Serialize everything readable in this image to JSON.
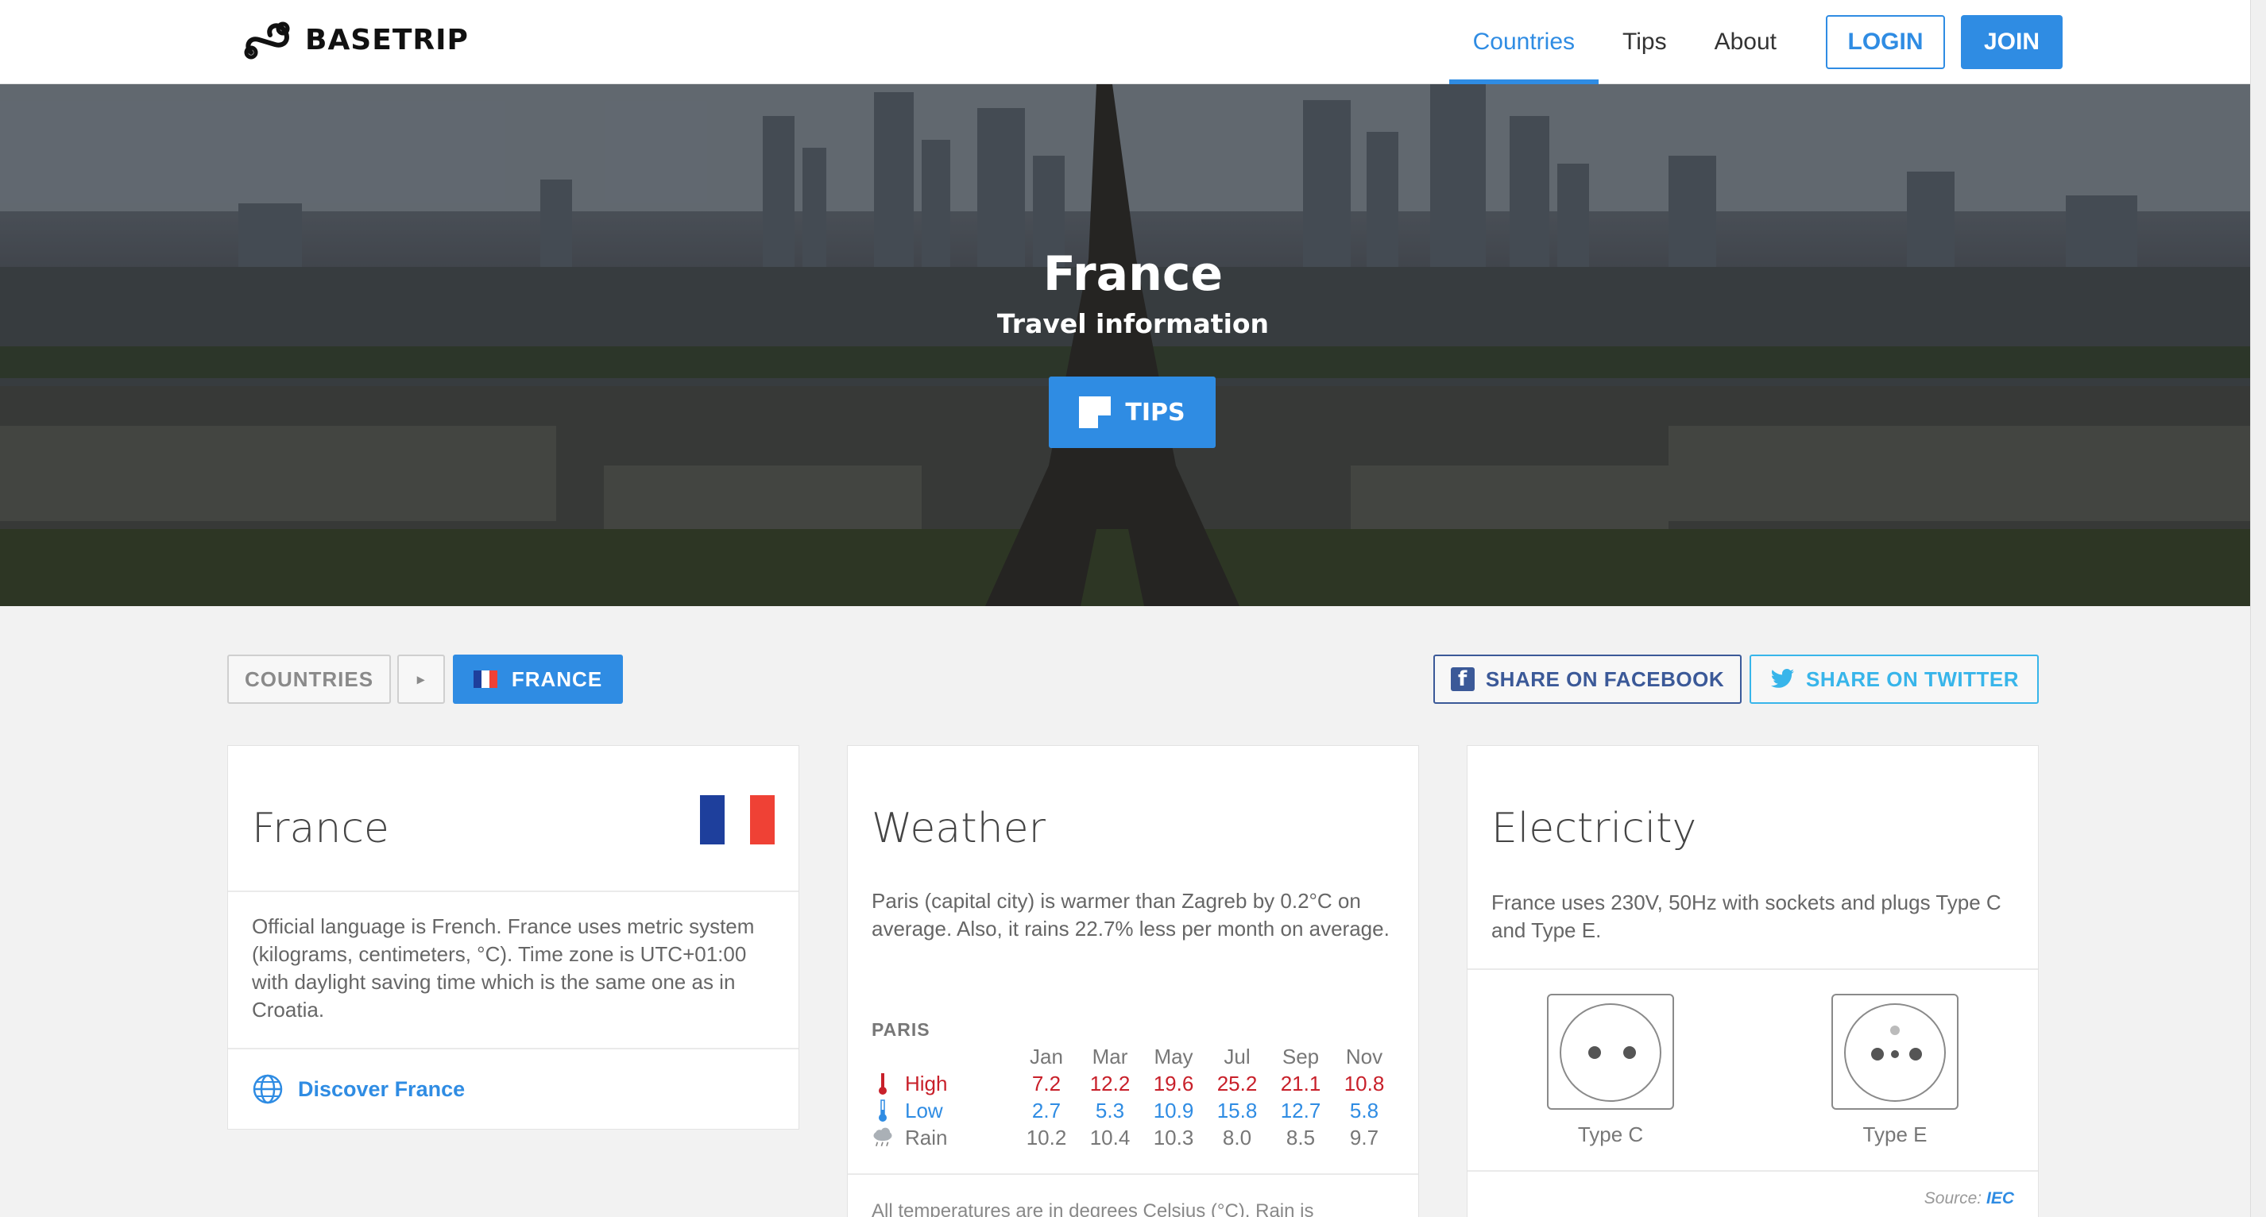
{
  "brand": {
    "name": "BASETRIP"
  },
  "nav": {
    "countries": "Countries",
    "tips": "Tips",
    "about": "About",
    "login": "LOGIN",
    "join": "JOIN"
  },
  "hero": {
    "title": "France",
    "subtitle": "Travel information",
    "tips_button": "TIPS"
  },
  "breadcrumb": {
    "countries": "COUNTRIES",
    "separator": "▸",
    "current": "FRANCE"
  },
  "share": {
    "facebook": "SHARE ON FACEBOOK",
    "twitter": "SHARE ON TWITTER"
  },
  "country_card": {
    "title": "France",
    "text": "Official language is French. France uses metric system (kilograms, centimeters, °C). Time zone is UTC+01:00 with daylight saving time which is the same one as in Croatia.",
    "link": "Discover France",
    "flag_colors": [
      "#1e3f9c",
      "#ffffff",
      "#ef4135"
    ]
  },
  "weather_card": {
    "title": "Weather",
    "text": "Paris (capital city) is warmer than Zagreb by 0.2°C on average. Also, it rains 22.7% less per month on average.",
    "city": "PARIS",
    "months": [
      "Jan",
      "Mar",
      "May",
      "Jul",
      "Sep",
      "Nov"
    ],
    "high_label": "High",
    "low_label": "Low",
    "rain_label": "Rain",
    "high": [
      "7.2",
      "12.2",
      "19.6",
      "25.2",
      "21.1",
      "10.8"
    ],
    "low": [
      "2.7",
      "5.3",
      "10.9",
      "15.8",
      "12.7",
      "5.8"
    ],
    "rain": [
      "10.2",
      "10.4",
      "10.3",
      "8.0",
      "8.5",
      "9.7"
    ],
    "footnote": "All temperatures are in degrees Celsius (°C). Rain is"
  },
  "electricity_card": {
    "title": "Electricity",
    "text": "France uses 230V, 50Hz with sockets and plugs Type C and Type E.",
    "socket_c": "Type C",
    "socket_e": "Type E",
    "source_label": "Source:",
    "source_name": "IEC"
  },
  "colors": {
    "accent": "#2f8ce3",
    "facebook": "#3b5998",
    "twitter": "#38b5ea",
    "high": "#c8202a"
  }
}
